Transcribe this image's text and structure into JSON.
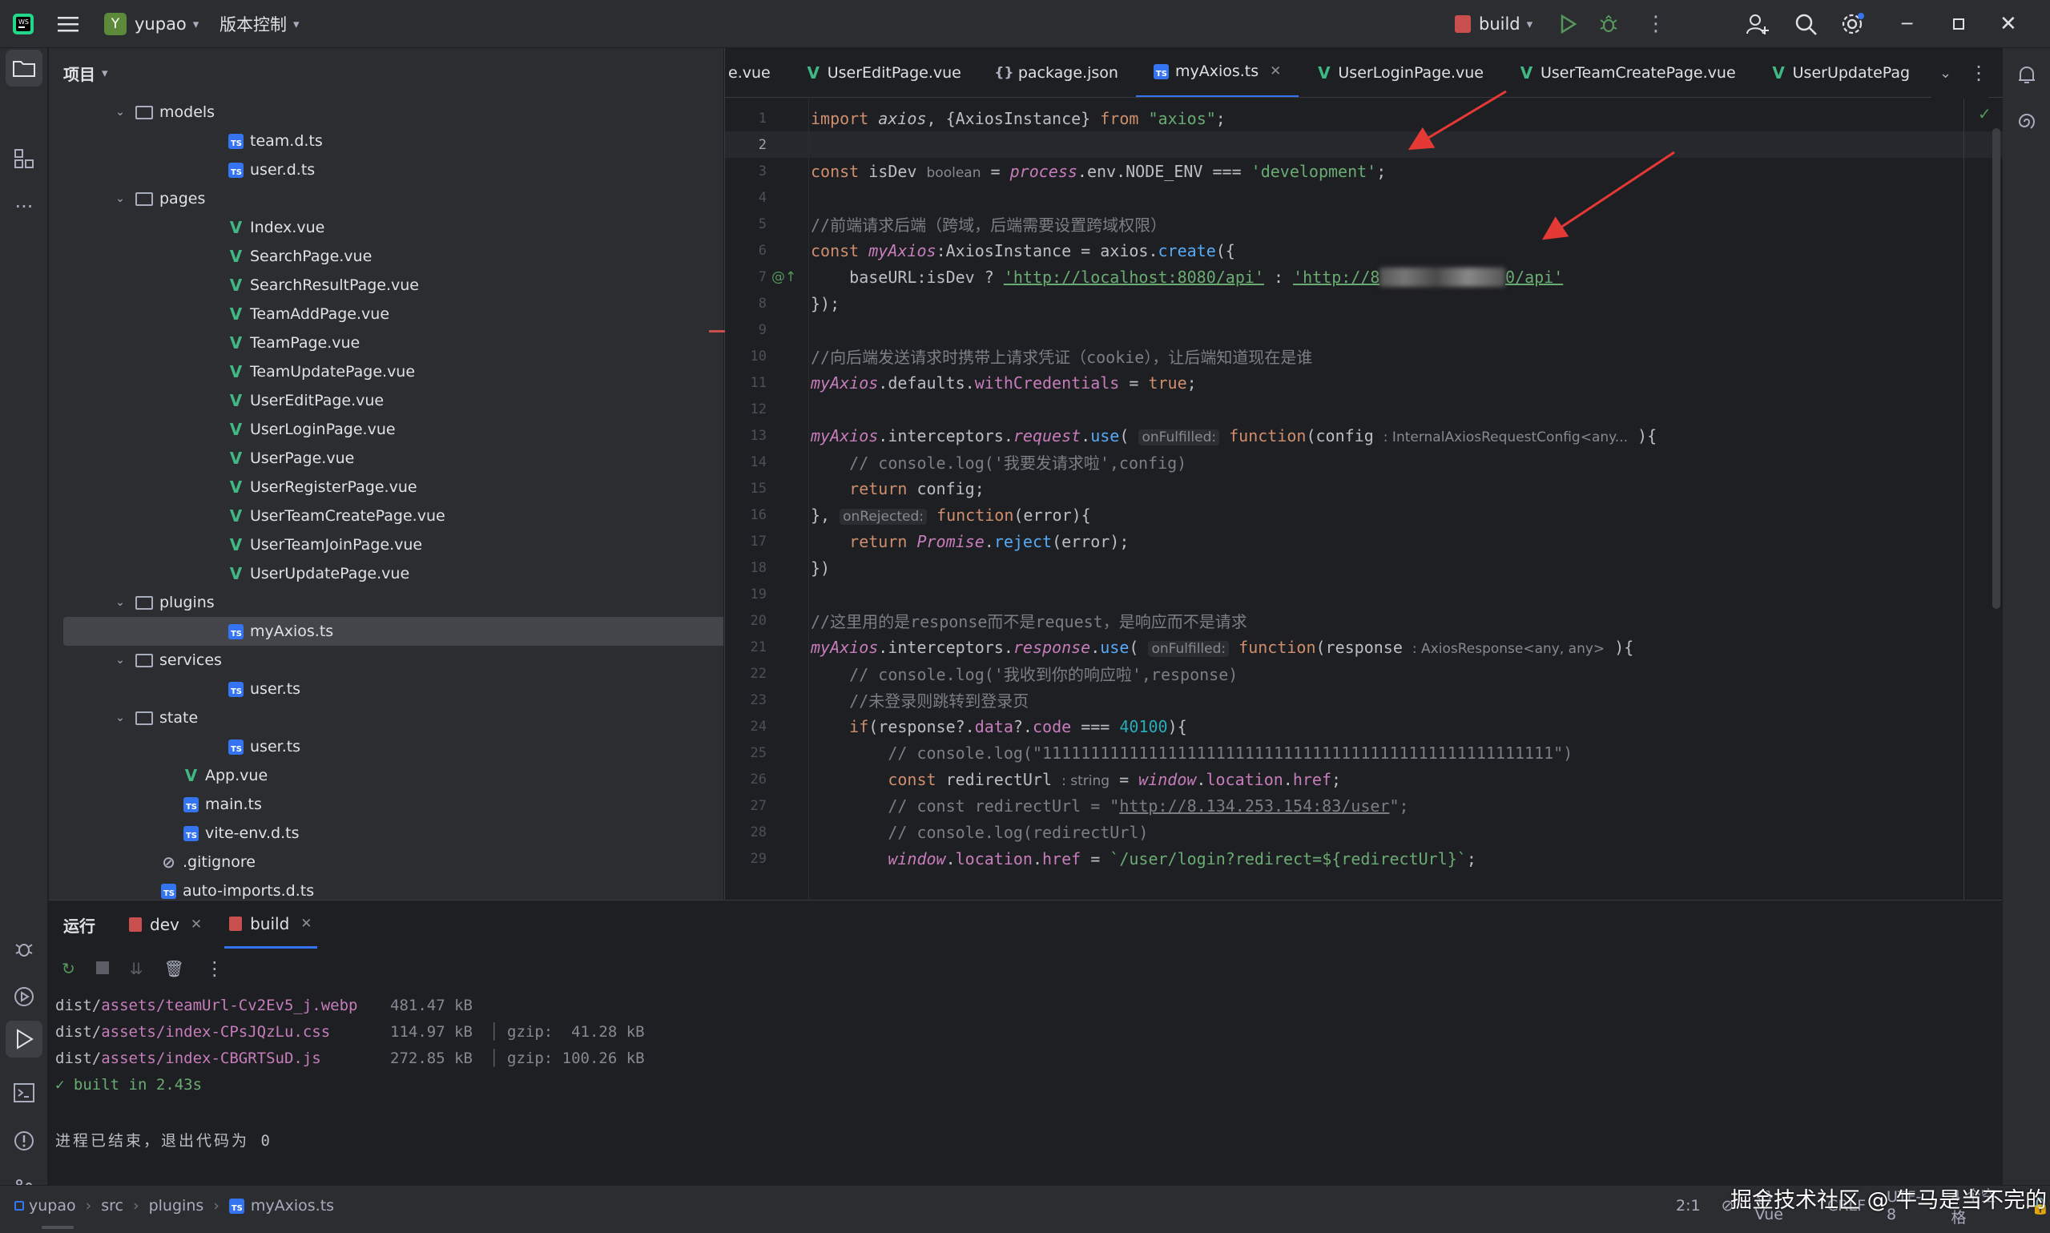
{
  "app": {
    "project_initial": "Y",
    "project_name": "yupao",
    "vcs_label": "版本控制",
    "run_config": "build"
  },
  "project_panel": {
    "title": "项目"
  },
  "tree": [
    {
      "label": "models",
      "kind": "folder",
      "depth": 3
    },
    {
      "label": "team.d.ts",
      "kind": "ts",
      "depth": 4
    },
    {
      "label": "user.d.ts",
      "kind": "ts",
      "depth": 4
    },
    {
      "label": "pages",
      "kind": "folder",
      "depth": 3
    },
    {
      "label": "Index.vue",
      "kind": "vue",
      "depth": 4
    },
    {
      "label": "SearchPage.vue",
      "kind": "vue",
      "depth": 4
    },
    {
      "label": "SearchResultPage.vue",
      "kind": "vue",
      "depth": 4
    },
    {
      "label": "TeamAddPage.vue",
      "kind": "vue",
      "depth": 4
    },
    {
      "label": "TeamPage.vue",
      "kind": "vue",
      "depth": 4
    },
    {
      "label": "TeamUpdatePage.vue",
      "kind": "vue",
      "depth": 4
    },
    {
      "label": "UserEditPage.vue",
      "kind": "vue",
      "depth": 4
    },
    {
      "label": "UserLoginPage.vue",
      "kind": "vue",
      "depth": 4
    },
    {
      "label": "UserPage.vue",
      "kind": "vue",
      "depth": 4
    },
    {
      "label": "UserRegisterPage.vue",
      "kind": "vue",
      "depth": 4
    },
    {
      "label": "UserTeamCreatePage.vue",
      "kind": "vue",
      "depth": 4
    },
    {
      "label": "UserTeamJoinPage.vue",
      "kind": "vue",
      "depth": 4
    },
    {
      "label": "UserUpdatePage.vue",
      "kind": "vue",
      "depth": 4
    },
    {
      "label": "plugins",
      "kind": "folder",
      "depth": 3
    },
    {
      "label": "myAxios.ts",
      "kind": "ts",
      "depth": 4,
      "selected": true
    },
    {
      "label": "services",
      "kind": "folder",
      "depth": 3
    },
    {
      "label": "user.ts",
      "kind": "ts",
      "depth": 4
    },
    {
      "label": "state",
      "kind": "folder",
      "depth": 3
    },
    {
      "label": "user.ts",
      "kind": "ts",
      "depth": 4
    },
    {
      "label": "App.vue",
      "kind": "vue",
      "depth": 3
    },
    {
      "label": "main.ts",
      "kind": "ts",
      "depth": 3
    },
    {
      "label": "vite-env.d.ts",
      "kind": "ts",
      "depth": 3
    },
    {
      "label": ".gitignore",
      "kind": "ignore",
      "depth": 2
    },
    {
      "label": "auto-imports.d.ts",
      "kind": "ts",
      "depth": 2
    }
  ],
  "tabs": [
    {
      "label": "e.vue",
      "kind": "none"
    },
    {
      "label": "UserEditPage.vue",
      "kind": "vue"
    },
    {
      "label": "package.json",
      "kind": "json"
    },
    {
      "label": "myAxios.ts",
      "kind": "ts",
      "active": true
    },
    {
      "label": "UserLoginPage.vue",
      "kind": "vue"
    },
    {
      "label": "UserTeamCreatePage.vue",
      "kind": "vue"
    },
    {
      "label": "UserUpdatePag",
      "kind": "vue"
    }
  ],
  "editor": {
    "line_numbers": [
      "1",
      "2",
      "3",
      "4",
      "5",
      "6",
      "7",
      "8",
      "9",
      "10",
      "11",
      "12",
      "13",
      "14",
      "15",
      "16",
      "17",
      "18",
      "19",
      "20",
      "21",
      "22",
      "23",
      "24",
      "25",
      "26",
      "27",
      "28",
      "29"
    ],
    "current_line": 2,
    "tokens": {
      "l1_import": "import",
      "l1_axios": "axios",
      "l1_inst": ", {AxiosInstance} ",
      "l1_from": "from",
      "l1_str": "\"axios\"",
      "l1_semi": ";",
      "l3_const": "const",
      "l3_name": " isDev ",
      "l3_hint": "boolean",
      "l3_eq": " = ",
      "l3_process": "process",
      "l3_env": ".env.NODE_ENV === ",
      "l3_str": "'development'",
      "l3_semi": ";",
      "l5_comment": "//前端请求后端（跨域，后端需要设置跨域权限）",
      "l6_const": "const",
      "l6_name": "myAxios",
      "l6_type": ":AxiosInstance = axios.",
      "l6_fn": "create",
      "l6_end": "({",
      "l7_base": "baseURL:isDev ? ",
      "l7_s1": "'http://localhost:8080/api'",
      "l7_colon": " : ",
      "l7_s2a": "'http://8",
      "l7_blur": "xxx.xxx.xx:xx",
      "l7_s2b": "0/api'",
      "l8": "});",
      "l10_comment": "//向后端发送请求时携带上请求凭证（cookie），让后端知道现在是谁",
      "l11_name": "myAxios",
      "l11_mid": ".defaults.",
      "l11_prop": "withCredentials",
      "l11_eq": " = ",
      "l11_true": "true",
      "l11_semi": ";",
      "l13_name": "myAxios",
      "l13_a": ".interceptors.",
      "l13_req": "request",
      "l13_b": ".",
      "l13_use": "use",
      "l13_c": "( ",
      "l13_hint": "onFulfilled:",
      "l13_fn": " function",
      "l13_d": "(config ",
      "l13_hint2": ": InternalAxiosRequestConfig<any...",
      "l13_e": " ){",
      "l14": "// console.log('我要发请求啦',config)",
      "l15_ret": "return",
      "l15_rest": " config;",
      "l16_a": "}, ",
      "l16_hint": "onRejected:",
      "l16_fn": " function",
      "l16_b": "(error){",
      "l17_ret": "return",
      "l17_promise": "Promise",
      "l17_dot": ".",
      "l17_reject": "reject",
      "l17_end": "(error);",
      "l18": "})",
      "l20_comment": "//这里用的是response而不是request，是响应而不是请求",
      "l21_name": "myAxios",
      "l21_a": ".interceptors.",
      "l21_res": "response",
      "l21_b": ".",
      "l21_use": "use",
      "l21_c": "( ",
      "l21_hint": "onFulfilled:",
      "l21_fn": " function",
      "l21_d": "(response ",
      "l21_hint2": ": AxiosResponse<any, any>",
      "l21_e": " ){",
      "l22": "// console.log('我收到你的响应啦',response)",
      "l23": "//未登录则跳转到登录页",
      "l24_if": "if",
      "l24_a": "(response?.",
      "l24_data": "data",
      "l24_b": "?.",
      "l24_code": "code",
      "l24_c": " === ",
      "l24_num": "40100",
      "l24_d": "){",
      "l25": "// console.log(\"11111111111111111111111111111111111111111111111111111\")",
      "l26_const": "const",
      "l26_name": " redirectUrl ",
      "l26_hint": ": string",
      "l26_eq": " = ",
      "l26_win": "window",
      "l26_dot": ".",
      "l26_loc": "location",
      "l26_dot2": ".",
      "l26_href": "href",
      "l26_semi": ";",
      "l27_a": "// const redirectUrl = \"",
      "l27_url": "http://8.134.253.154:83/user",
      "l27_b": "\";",
      "l28": "// console.log(redirectUrl)",
      "l29_win": "window",
      "l29_dot": ".",
      "l29_loc": "location",
      "l29_dot2": ".",
      "l29_href": "href",
      "l29_eq": " = ",
      "l29_str": "`/user/login?redirect=${redirectUrl}`",
      "l29_semi": ";"
    }
  },
  "run_panel": {
    "title": "运行",
    "tabs": [
      "dev",
      "build"
    ]
  },
  "output": [
    {
      "path": "dist/",
      "file": "assets/teamUrl-Cv2Ev5_j.webp",
      "size": "481.47 kB",
      "gzip": ""
    },
    {
      "path": "dist/",
      "file": "assets/index-CPsJQzLu.css",
      "size": "114.97 kB",
      "gzip": "gzip:  41.28 kB"
    },
    {
      "path": "dist/",
      "file": "assets/index-CBGRTSuD.js",
      "size": "272.85 kB",
      "gzip": "gzip: 100.26 kB"
    }
  ],
  "built_msg": "✓ built in 2.43s",
  "exit_msg": "进程已结束，退出代码为 0",
  "status": {
    "crumbs": [
      "yupao",
      "src",
      "plugins",
      "myAxios.ts"
    ],
    "pos": "2:1",
    "lang": "{} Vue",
    "eol": "CRLF",
    "enc": "UTF-8",
    "indent": "4 个空格",
    "watermark": "掘金技术社区 @ 牛马是当不完的"
  },
  "colors": {
    "accent": "#3574f0",
    "vue": "#41b883",
    "keyword": "#cf8e6d",
    "string": "#6aab73",
    "arrow": "#e53935"
  }
}
